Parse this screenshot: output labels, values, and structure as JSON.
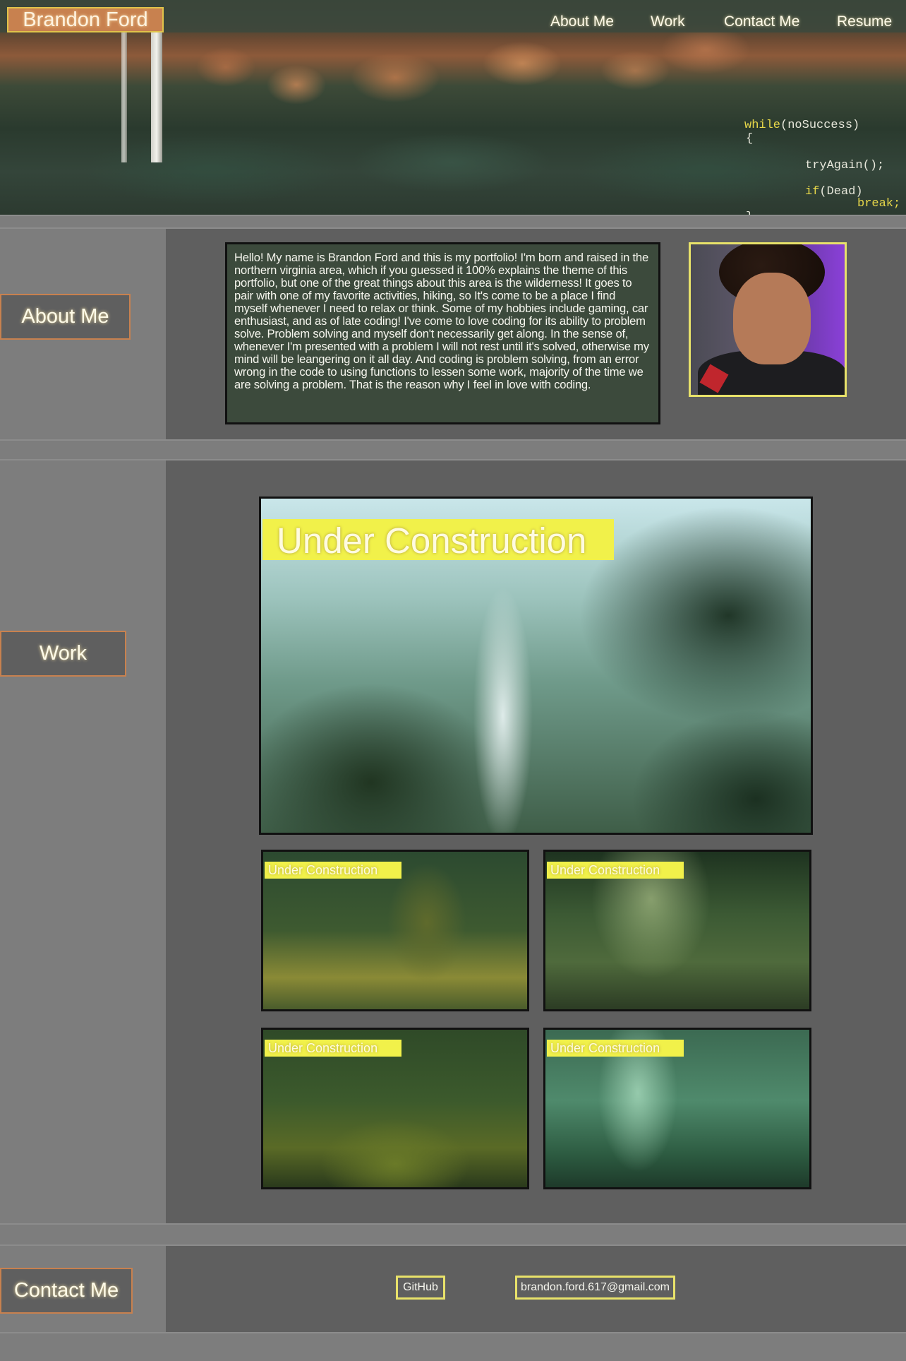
{
  "header": {
    "brand": "Brandon Ford",
    "nav": [
      "About Me",
      "Work",
      "Contact Me",
      "Resume"
    ],
    "code_overlay": {
      "line1_kw": "while",
      "line1_rest": "(noSuccess)",
      "line2": "{",
      "line3": "tryAgain();",
      "line4_kw": "if",
      "line4_rest": "(Dead)",
      "line5": "break;",
      "line6": "}"
    }
  },
  "about": {
    "label": "About Me",
    "text": "Hello! My name is Brandon Ford and this is my portfolio! I'm born and raised in the northern virginia area, which if you guessed it 100% explains the theme of this portfolio, but one of the great things about this area is the wilderness! It goes to pair with one of my favorite activities, hiking, so It's come to be a place I find myself whenever I need to relax or think. Some of my hobbies include gaming, car enthusiast, and as of late coding! I've come to love coding for its ability to problem solve. Problem solving and myself don't necessarily get along. In the sense of, whenever I'm presented with a problem I will not rest until it's solved, otherwise my mind will be leangering on it all day. And coding is problem solving, from an error wrong in the code to using functions to lessen some work, majority of the time we are solving a problem. That is the reason why I feel in love with coding."
  },
  "work": {
    "label": "Work",
    "featured_label": "Under Construction",
    "items": [
      "Under Construction",
      "Under Construction",
      "Under Construction",
      "Under Construction"
    ]
  },
  "contact": {
    "label": "Contact Me",
    "github": "GitHub",
    "email": "brandon.ford.617@gmail.com"
  },
  "colors": {
    "accent_yellow": "#e8e26a",
    "accent_orange": "#c8814f",
    "panel_dark": "#3c4a3c",
    "section_bg": "#5f5f5f"
  }
}
